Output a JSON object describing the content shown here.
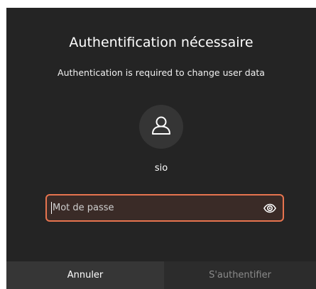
{
  "dialog": {
    "title": "Authentification nécessaire",
    "message": "Authentication is required to change user data",
    "username": "sio",
    "password_placeholder": "Mot de passe",
    "cancel_label": "Annuler",
    "authenticate_label": "S'authentifier"
  },
  "icons": {
    "avatar": "user-icon",
    "reveal": "eye-icon"
  },
  "colors": {
    "dialog_background": "#242424",
    "focus_border": "#e7744f",
    "cancel_button": "#363636",
    "auth_button": "#2c2c2c",
    "disabled_text": "#8a8a8a"
  }
}
